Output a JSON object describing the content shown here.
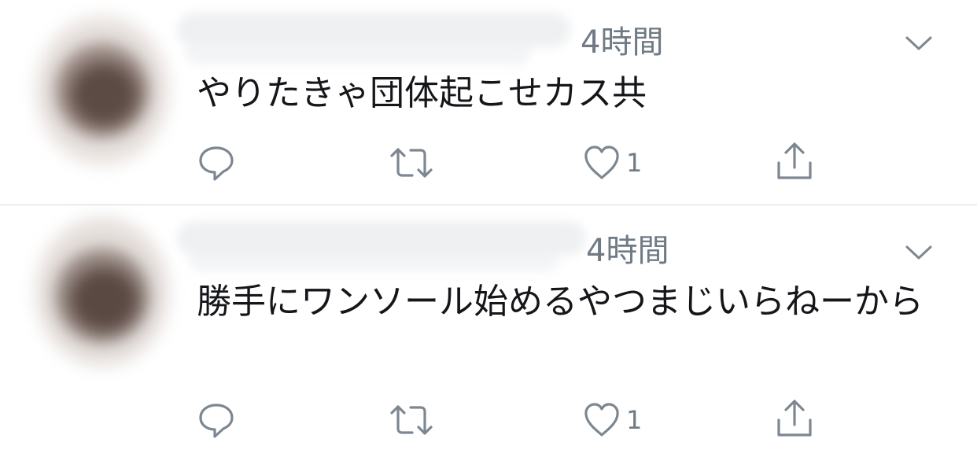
{
  "tweets": [
    {
      "time": "4時間",
      "text": "やりたきゃ団体起こせカス共",
      "actions": {
        "reply_icon": "reply-icon",
        "retweet_icon": "retweet-icon",
        "like_icon": "heart-icon",
        "like_count": "1",
        "share_icon": "share-icon"
      }
    },
    {
      "time": "4時間",
      "text": "勝手にワンソール始めるやつまじいらねーから",
      "actions": {
        "reply_icon": "reply-icon",
        "retweet_icon": "retweet-icon",
        "like_icon": "heart-icon",
        "like_count": "1",
        "share_icon": "share-icon"
      }
    }
  ],
  "colors": {
    "text": "#141619",
    "secondary": "#6f7a85",
    "icon": "#7d8791",
    "divider": "#d3d8dc"
  }
}
